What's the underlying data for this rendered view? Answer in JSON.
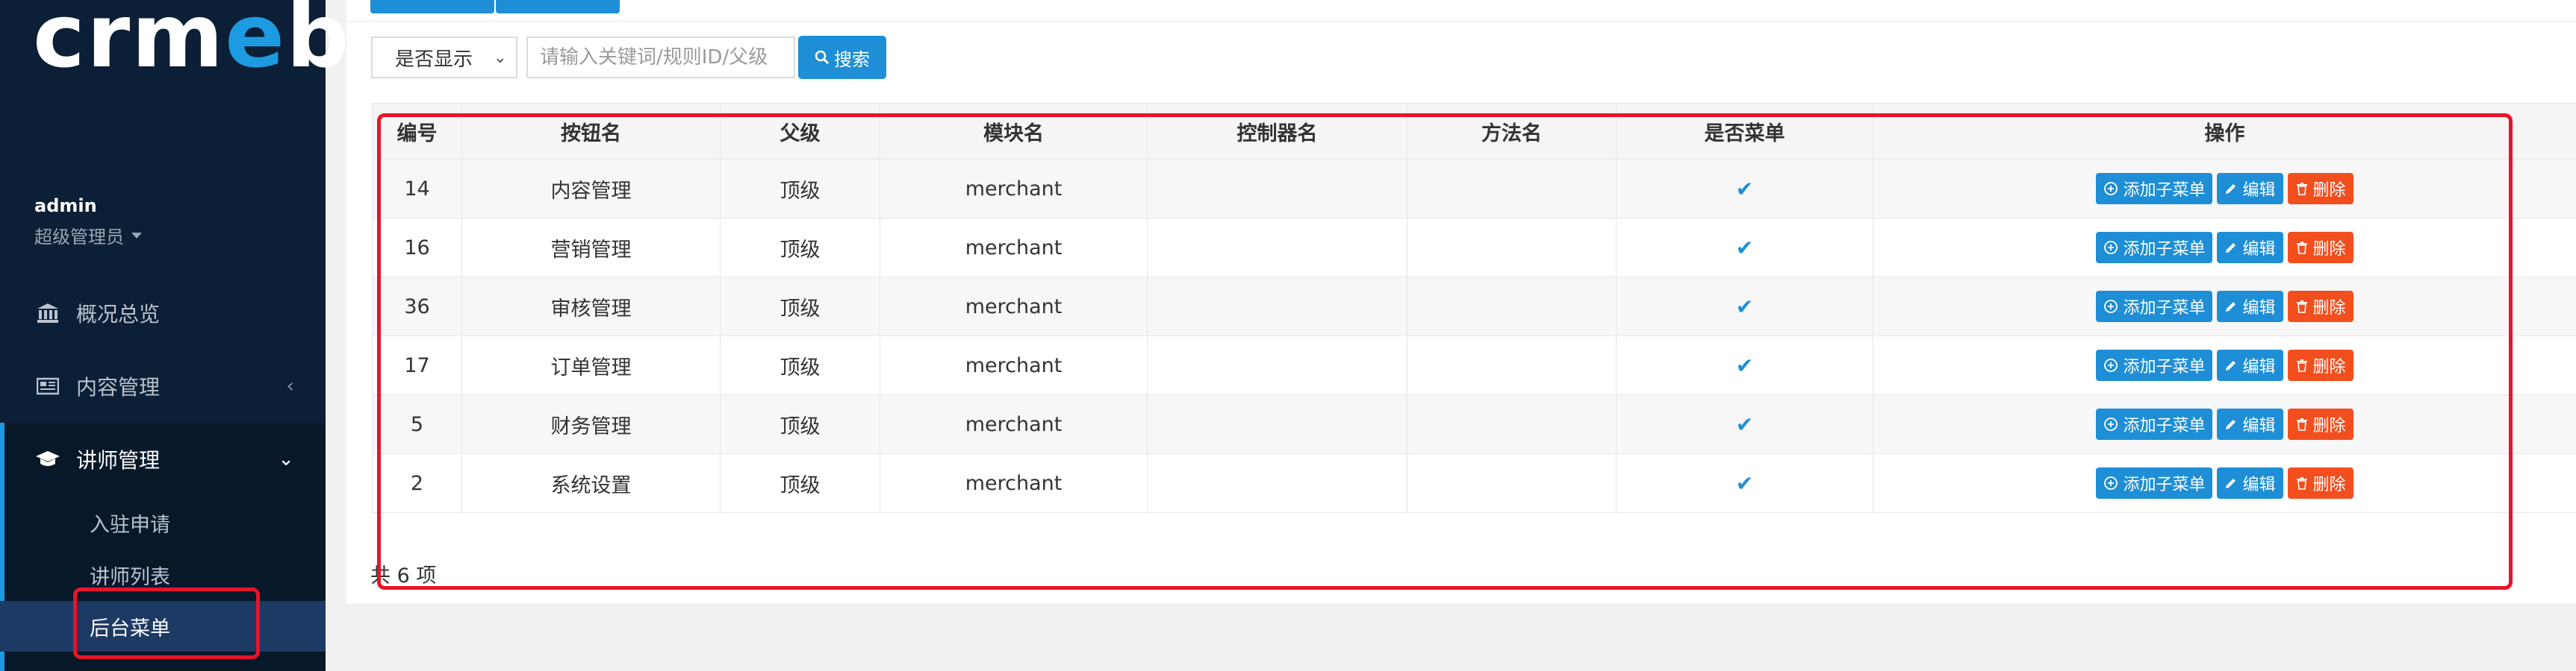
{
  "sidebar": {
    "logo": {
      "part1": "crm",
      "part2": "e",
      "part3": "b"
    },
    "user": {
      "name": "admin",
      "role": "超级管理员"
    },
    "nav": [
      {
        "label": "概况总览"
      },
      {
        "label": "内容管理"
      },
      {
        "label": "讲师管理"
      }
    ],
    "sub_items": [
      {
        "label": "入驻申请"
      },
      {
        "label": "讲师列表"
      },
      {
        "label": "后台菜单"
      }
    ]
  },
  "filter": {
    "select_value": "是否显示",
    "search_placeholder": "请输入关键词/规则ID/父级",
    "search_button": "搜索"
  },
  "table": {
    "headers": [
      "编号",
      "按钮名",
      "父级",
      "模块名",
      "控制器名",
      "方法名",
      "是否菜单",
      "操作"
    ],
    "rows": [
      {
        "id": "14",
        "name": "内容管理",
        "parent": "顶级",
        "module": "merchant",
        "controller": "",
        "method": "",
        "is_menu": true
      },
      {
        "id": "16",
        "name": "营销管理",
        "parent": "顶级",
        "module": "merchant",
        "controller": "",
        "method": "",
        "is_menu": true
      },
      {
        "id": "36",
        "name": "审核管理",
        "parent": "顶级",
        "module": "merchant",
        "controller": "",
        "method": "",
        "is_menu": true
      },
      {
        "id": "17",
        "name": "订单管理",
        "parent": "顶级",
        "module": "merchant",
        "controller": "",
        "method": "",
        "is_menu": true
      },
      {
        "id": "5",
        "name": "财务管理",
        "parent": "顶级",
        "module": "merchant",
        "controller": "",
        "method": "",
        "is_menu": true
      },
      {
        "id": "2",
        "name": "系统设置",
        "parent": "顶级",
        "module": "merchant",
        "controller": "",
        "method": "",
        "is_menu": true
      }
    ],
    "actions": {
      "add": "添加子菜单",
      "edit": "编辑",
      "delete": "删除"
    },
    "total": "共 6 项"
  },
  "colors": {
    "sidebar_bg": "#0b1f36",
    "accent": "#1e8ed6",
    "danger": "#f24e1e",
    "highlight_box": "#e8132c"
  }
}
